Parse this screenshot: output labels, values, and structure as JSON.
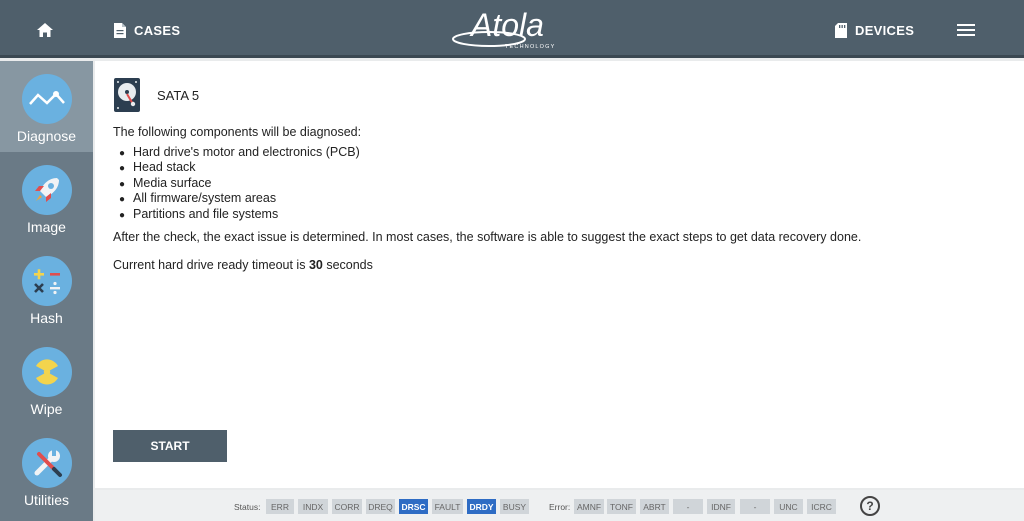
{
  "topbar": {
    "cases_label": "CASES",
    "logo_text": "Atola",
    "logo_subtext": "TECHNOLOGY",
    "devices_label": "DEVICES"
  },
  "sidebar": {
    "items": [
      {
        "label": "Diagnose",
        "icon": "diagnose-wave-icon",
        "active": true
      },
      {
        "label": "Image",
        "icon": "rocket-icon",
        "active": false
      },
      {
        "label": "Hash",
        "icon": "math-operators-icon",
        "active": false
      },
      {
        "label": "Wipe",
        "icon": "radiation-icon",
        "active": false
      },
      {
        "label": "Utilities",
        "icon": "wrench-screwdriver-icon",
        "active": false
      }
    ]
  },
  "main": {
    "drive_name": "SATA 5",
    "intro": "The following components will be diagnosed:",
    "components": [
      "Hard drive's motor and electronics (PCB)",
      "Head stack",
      "Media surface",
      "All firmware/system areas",
      "Partitions and file systems"
    ],
    "after_text": "After the check, the exact issue is determined. In most cases, the software is able to suggest the exact steps to get data recovery done.",
    "timeout_prefix": "Current hard drive ready timeout is",
    "timeout_value": "30",
    "timeout_suffix": "seconds",
    "start_label": "START"
  },
  "statusbar": {
    "status_label": "Status:",
    "status_flags": [
      {
        "label": "ERR",
        "on": false
      },
      {
        "label": "INDX",
        "on": false
      },
      {
        "label": "CORR",
        "on": false
      },
      {
        "label": "DREQ",
        "on": false
      },
      {
        "label": "DRSC",
        "on": true
      },
      {
        "label": "FAULT",
        "on": false
      },
      {
        "label": "DRDY",
        "on": true
      },
      {
        "label": "BUSY",
        "on": false
      }
    ],
    "error_label": "Error:",
    "error_flags": [
      {
        "label": "AMNF",
        "on": false
      },
      {
        "label": "TONF",
        "on": false
      },
      {
        "label": "ABRT",
        "on": false
      },
      {
        "label": "-",
        "on": false
      },
      {
        "label": "IDNF",
        "on": false
      },
      {
        "label": "-",
        "on": false
      },
      {
        "label": "UNC",
        "on": false
      },
      {
        "label": "ICRC",
        "on": false
      }
    ],
    "help_label": "?"
  },
  "colors": {
    "topbar": "#4f5f6b",
    "sidebar": "#6a7a86",
    "sidebar_active": "#8797a2",
    "icon_circle": "#6ab1e0",
    "flag_on": "#2e6cc4"
  }
}
